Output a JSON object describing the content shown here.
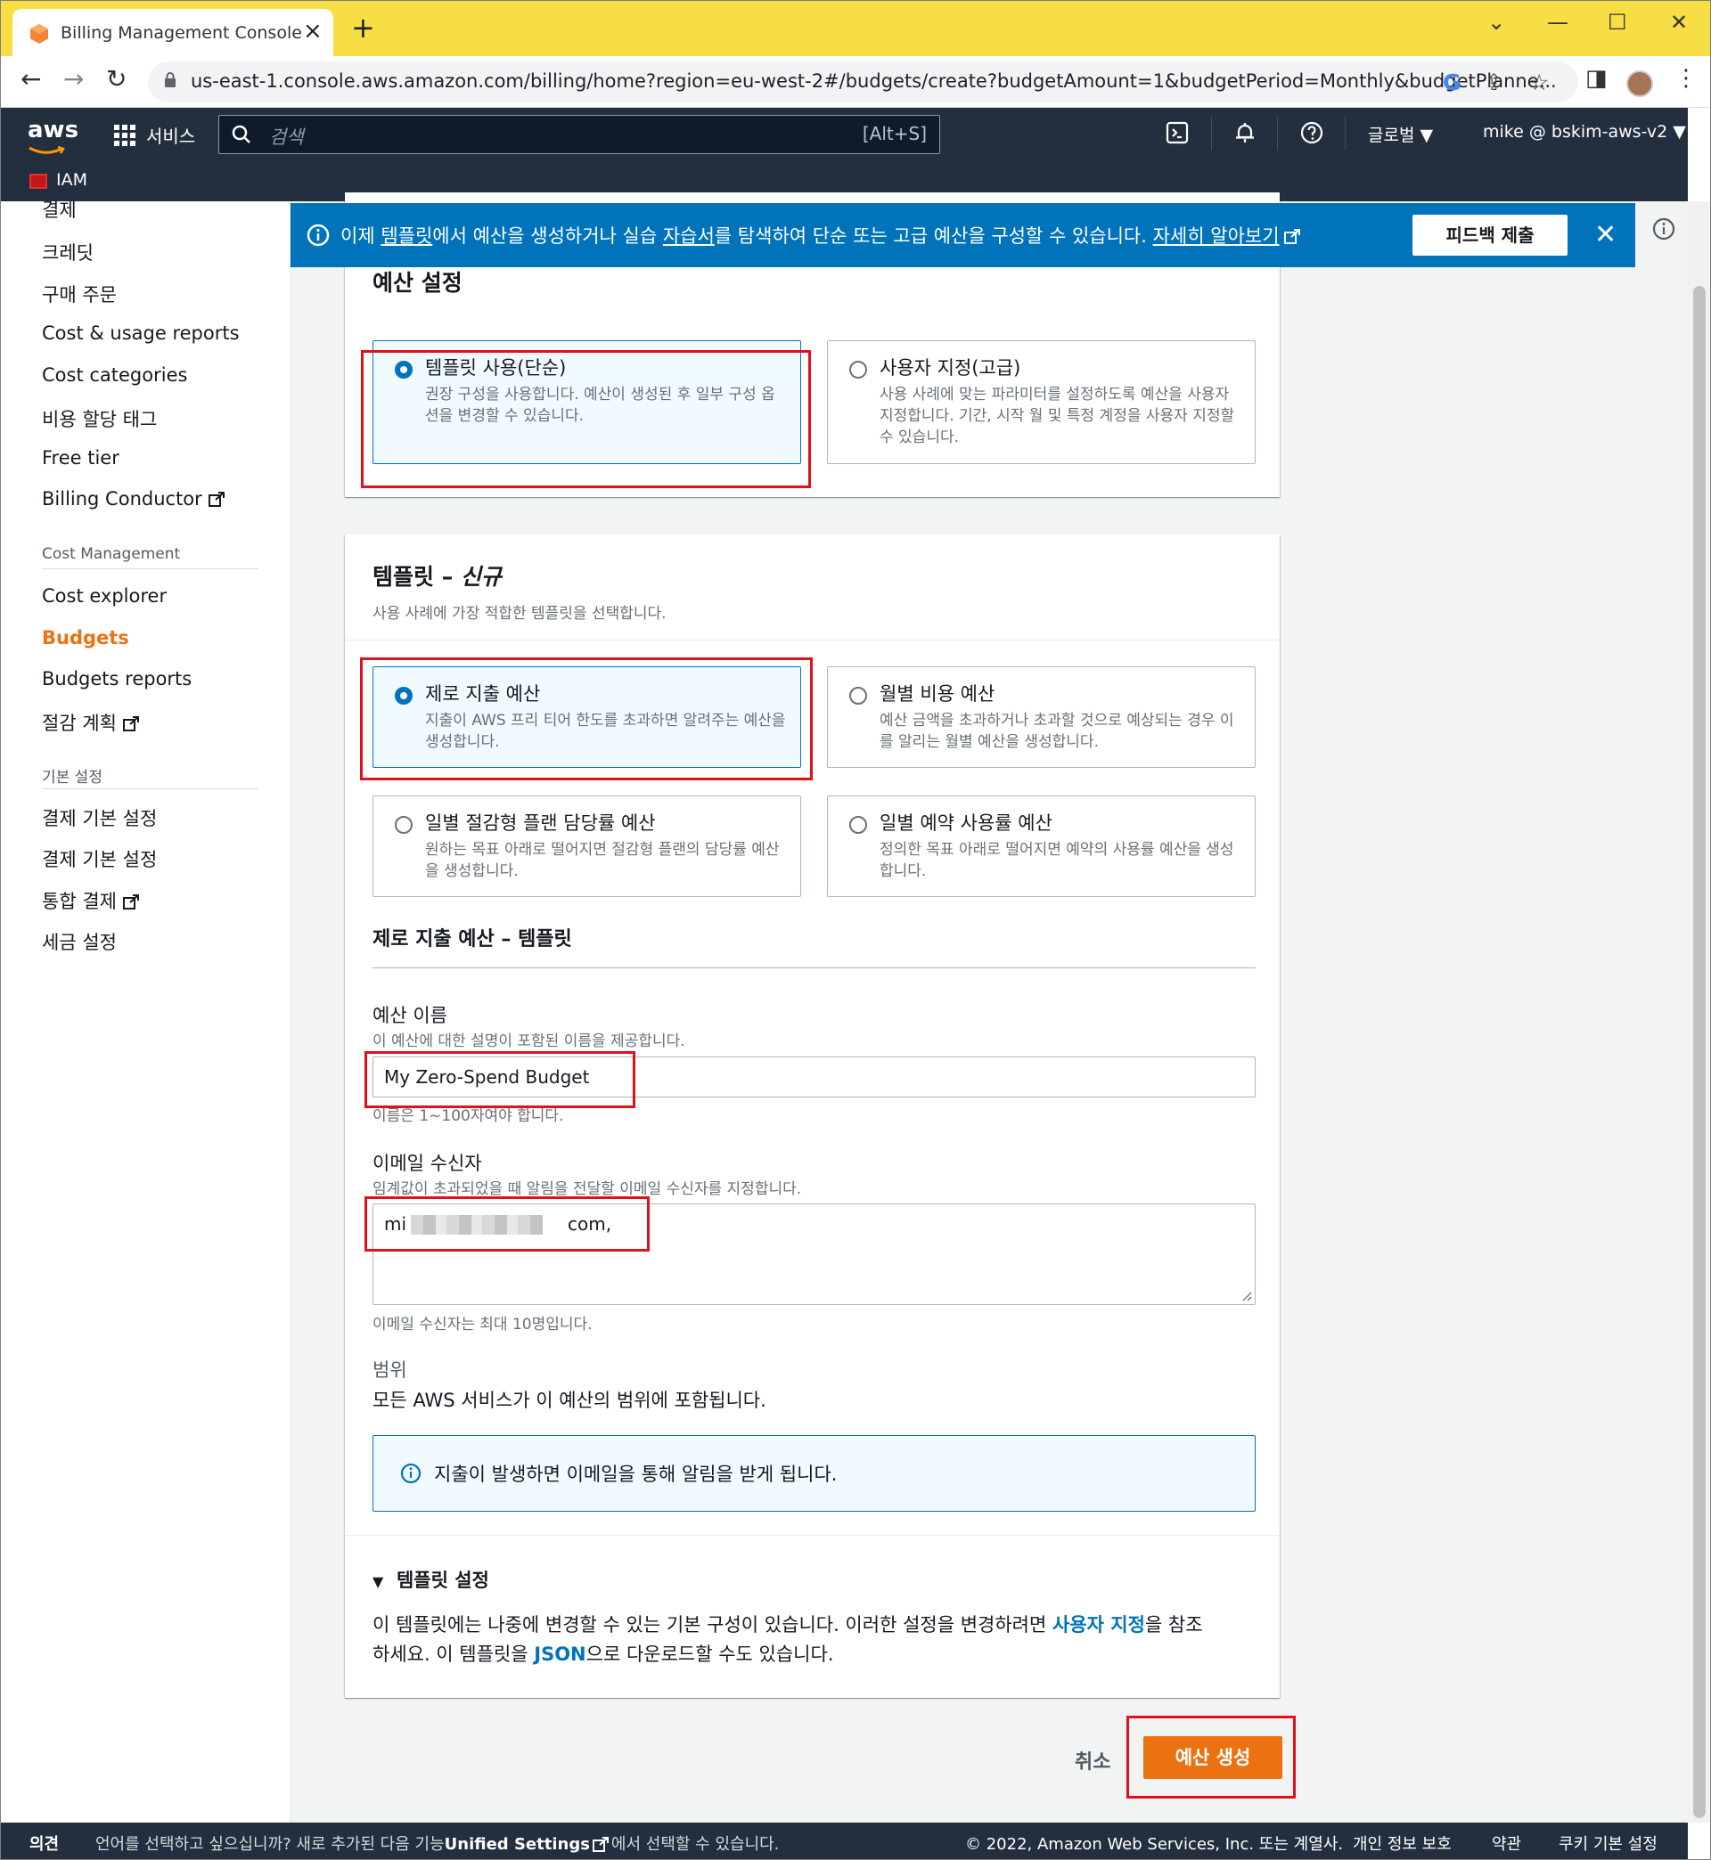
{
  "browser": {
    "tab_title": "Billing Management Console",
    "url": "us-east-1.console.aws.amazon.com/billing/home?region=eu-west-2#/budgets/create?budgetAmount=1&budgetPeriod=Monthly&budgetPlanne..."
  },
  "aws_header": {
    "logo": "aws",
    "services_label": "서비스",
    "search_placeholder": "검색",
    "search_shortcut": "[Alt+S]",
    "region": "글로벌",
    "account": "mike @ bskim-aws-v2",
    "favorite": "IAM"
  },
  "sidebar": {
    "items_top": [
      "결제",
      "크레딧",
      "구매 주문",
      "Cost & usage reports",
      "Cost categories",
      "비용 할당 태그",
      "Free tier",
      "Billing Conductor"
    ],
    "section_cost": "Cost Management",
    "items_cost": [
      "Cost explorer",
      "Budgets",
      "Budgets reports",
      "절감 계획"
    ],
    "section_prefs": "기본 설정",
    "items_prefs": [
      "결제 기본 설정",
      "결제 기본 설정",
      "통합 결제",
      "세금 설정"
    ]
  },
  "flash": {
    "prefix": "이제 ",
    "link1": "템플릿",
    "mid1": "에서 예산을 생성하거나 실습 ",
    "link2": "자습서",
    "mid2": "를 탐색하여 단순 또는 고급 예산을 구성할 수 있습니다. ",
    "link3": "자세히 알아보기",
    "feedback": "피드백 제출"
  },
  "budget_setup": {
    "title": "예산 설정",
    "option1_title": "템플릿 사용(단순)",
    "option1_desc": "권장 구성을 사용합니다. 예산이 생성된 후 일부 구성 옵션을 변경할 수 있습니다.",
    "option2_title": "사용자 지정(고급)",
    "option2_desc": "사용 사례에 맞는 파라미터를 설정하도록 예산을 사용자 지정합니다. 기간, 시작 월 및 특정 계정을 사용자 지정할 수 있습니다."
  },
  "templates": {
    "title": "템플릿 – ",
    "title_new": "신규",
    "subtitle": "사용 사례에 가장 적합한 템플릿을 선택합니다.",
    "t1_title": "제로 지출 예산",
    "t1_desc": "지출이 AWS 프리 티어 한도를 초과하면 알려주는 예산을 생성합니다.",
    "t2_title": "월별 비용 예산",
    "t2_desc": "예산 금액을 초과하거나 초과할 것으로 예상되는 경우 이를 알리는 월별 예산을 생성합니다.",
    "t3_title": "일별 절감형 플랜 담당률 예산",
    "t3_desc": "원하는 목표 아래로 떨어지면 절감형 플랜의 담당률 예산을 생성합니다.",
    "t4_title": "일별 예약 사용률 예산",
    "t4_desc": "정의한 목표 아래로 떨어지면 예약의 사용률 예산을 생성합니다."
  },
  "form": {
    "section_title": "제로 지출 예산 – 템플릿",
    "name_label": "예산 이름",
    "name_desc": "이 예산에 대한 설명이 포함된 이름을 제공합니다.",
    "name_value": "My Zero-Spend Budget",
    "name_constraint": "이름은 1~100자여야 합니다.",
    "email_label": "이메일 수신자",
    "email_desc": "임계값이 초과되었을 때 알림을 전달할 이메일 수신자를 지정합니다.",
    "email_prefix": "mi",
    "email_suffix": "com,",
    "email_constraint": "이메일 수신자는 최대 10명입니다.",
    "scope_label": "범위",
    "scope_value": "모든 AWS 서비스가 이 예산의 범위에 포함됩니다.",
    "info_text": "지출이 발생하면 이메일을 통해 알림을 받게 됩니다.",
    "settings_title": "템플릿 설정",
    "settings_text1": "이 템플릿에는 나중에 변경할 수 있는 기본 구성이 있습니다. 이러한 설정을 변경하려면 ",
    "settings_link1": "사용자 지정",
    "settings_text2": "을 참조",
    "settings_text3": "하세요. 이 템플릿을 ",
    "settings_link2": "JSON",
    "settings_text4": "으로 다운로드할 수도 있습니다."
  },
  "actions": {
    "cancel": "취소",
    "create": "예산 생성"
  },
  "footer": {
    "feedback": "의견",
    "lang_text": "언어를 선택하고 싶으십니까? 새로 추가된 다음 기능",
    "unified": "Unified Settings",
    "lang_text2": "에서 선택할 수 있습니다.",
    "copyright": "© 2022, Amazon Web Services, Inc. 또는 계열사.",
    "privacy": "개인 정보 보호",
    "terms": "약관",
    "cookies": "쿠키 기본 설정"
  }
}
